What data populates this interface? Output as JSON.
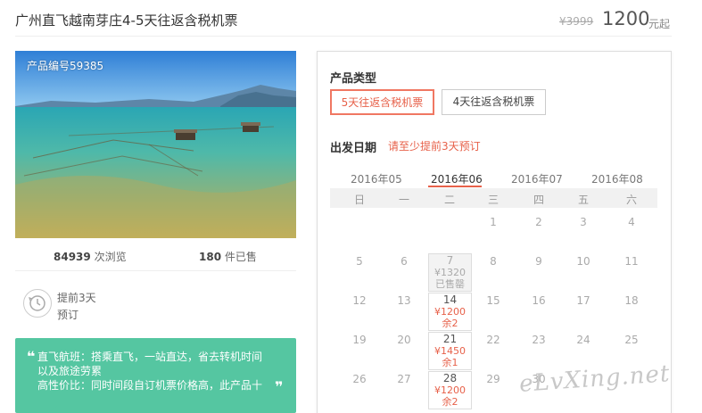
{
  "header": {
    "title": "广州直飞越南芽庄4-5天往返含税机票",
    "original_price": "¥3999",
    "price": "1200",
    "price_unit": "元起"
  },
  "product": {
    "number_label": "产品编号59385",
    "views_count": "84939",
    "views_label": "次浏览",
    "sold_count": "180",
    "sold_label": "件已售",
    "advance_line1": "提前3天",
    "advance_line2": "预订"
  },
  "features": {
    "quote_open": "❝",
    "quote_close": "❞",
    "lines": [
      "直飞航班：搭乘直飞，一站直达，省去转机时间",
      "以及旅途劳累",
      "高性价比：同时间段自订机票价格高，此产品十"
    ]
  },
  "booking": {
    "type_label": "产品类型",
    "types": [
      "5天往返含税机票",
      "4天往返含税机票"
    ],
    "date_label": "出发日期",
    "date_hint": "请至少提前3天预订",
    "months": [
      "2016年05",
      "2016年06",
      "2016年07",
      "2016年08"
    ],
    "active_month": "2016年06",
    "weekdays": [
      "日",
      "一",
      "二",
      "三",
      "四",
      "五",
      "六"
    ],
    "weeks": [
      [
        "",
        "",
        "",
        "1",
        "2",
        "3",
        "4"
      ],
      [
        "5",
        "6",
        "7",
        "8",
        "9",
        "10",
        "11"
      ],
      [
        "12",
        "13",
        "14",
        "15",
        "16",
        "17",
        "18"
      ],
      [
        "19",
        "20",
        "21",
        "22",
        "23",
        "24",
        "25"
      ],
      [
        "26",
        "27",
        "28",
        "29",
        "30",
        "",
        ""
      ]
    ],
    "tuesday_cells": [
      {
        "day": "7",
        "price": "¥1320",
        "status": "已售罄",
        "sold_out": true
      },
      {
        "day": "14",
        "price": "¥1200",
        "status": "余2",
        "sold_out": false
      },
      {
        "day": "21",
        "price": "¥1450",
        "status": "余1",
        "sold_out": false
      },
      {
        "day": "28",
        "price": "¥1200",
        "status": "余2",
        "sold_out": false
      }
    ]
  },
  "watermark": "eLvXing.net",
  "colors": {
    "accent": "#e7614a",
    "green": "#55c6a1"
  }
}
